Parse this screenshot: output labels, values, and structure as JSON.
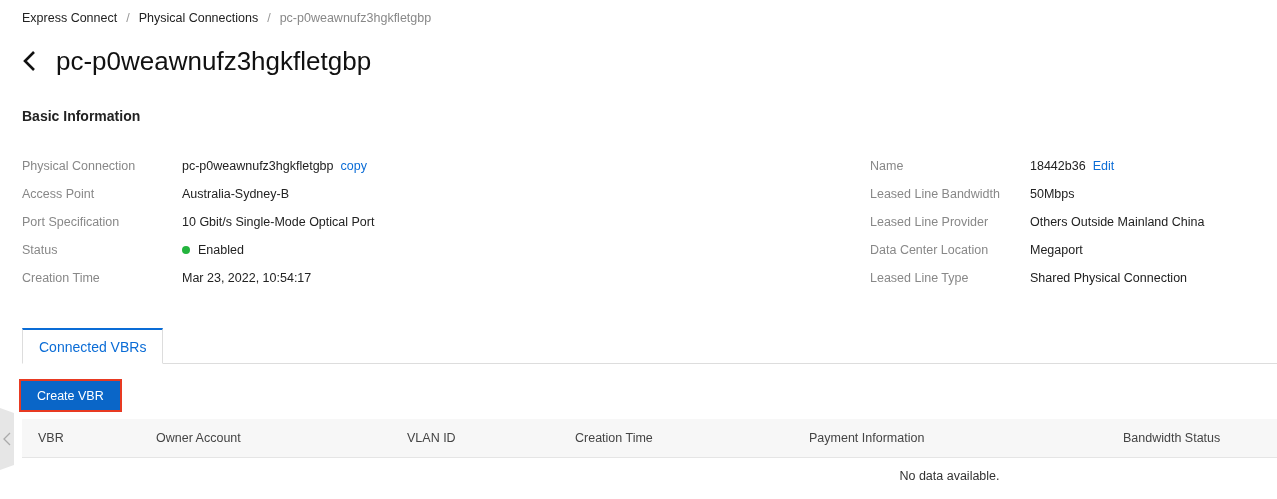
{
  "breadcrumb": [
    {
      "label": "Express Connect",
      "current": false
    },
    {
      "label": "Physical Connections",
      "current": false
    },
    {
      "label": "pc-p0weawnufz3hgkfletgbp",
      "current": true
    }
  ],
  "separator": "/",
  "title": "pc-p0weawnufz3hgkfletgbp",
  "section_title": "Basic Information",
  "info_left": [
    {
      "kind": "action",
      "label": "Physical Connection",
      "value": "pc-p0weawnufz3hgkfletgbp",
      "action": "copy"
    },
    {
      "kind": "plain",
      "label": "Access Point",
      "value": "Australia-Sydney-B"
    },
    {
      "kind": "plain",
      "label": "Port Specification",
      "value": "10 Gbit/s Single-Mode Optical Port"
    },
    {
      "kind": "status",
      "label": "Status",
      "value": "Enabled",
      "color": "#23b43d"
    },
    {
      "kind": "plain",
      "label": "Creation Time",
      "value": "Mar 23, 2022, 10:54:17"
    }
  ],
  "info_right": [
    {
      "kind": "action",
      "label": "Name",
      "value": "18442b36",
      "action": "Edit"
    },
    {
      "kind": "plain",
      "label": "Leased Line Bandwidth",
      "value": "50Mbps"
    },
    {
      "kind": "plain",
      "label": "Leased Line Provider",
      "value": "Others Outside Mainland China"
    },
    {
      "kind": "plain",
      "label": "Data Center Location",
      "value": "Megaport"
    },
    {
      "kind": "plain",
      "label": "Leased Line Type",
      "value": "Shared Physical Connection"
    }
  ],
  "tabs": [
    {
      "label": "Connected VBRs",
      "selected": true
    }
  ],
  "create_button": {
    "label": "Create VBR",
    "highlighted": true
  },
  "table": {
    "columns": [
      "VBR",
      "Owner Account",
      "VLAN ID",
      "Creation Time",
      "Payment Information",
      "Bandwidth Status"
    ],
    "empty_text": "No data available."
  }
}
